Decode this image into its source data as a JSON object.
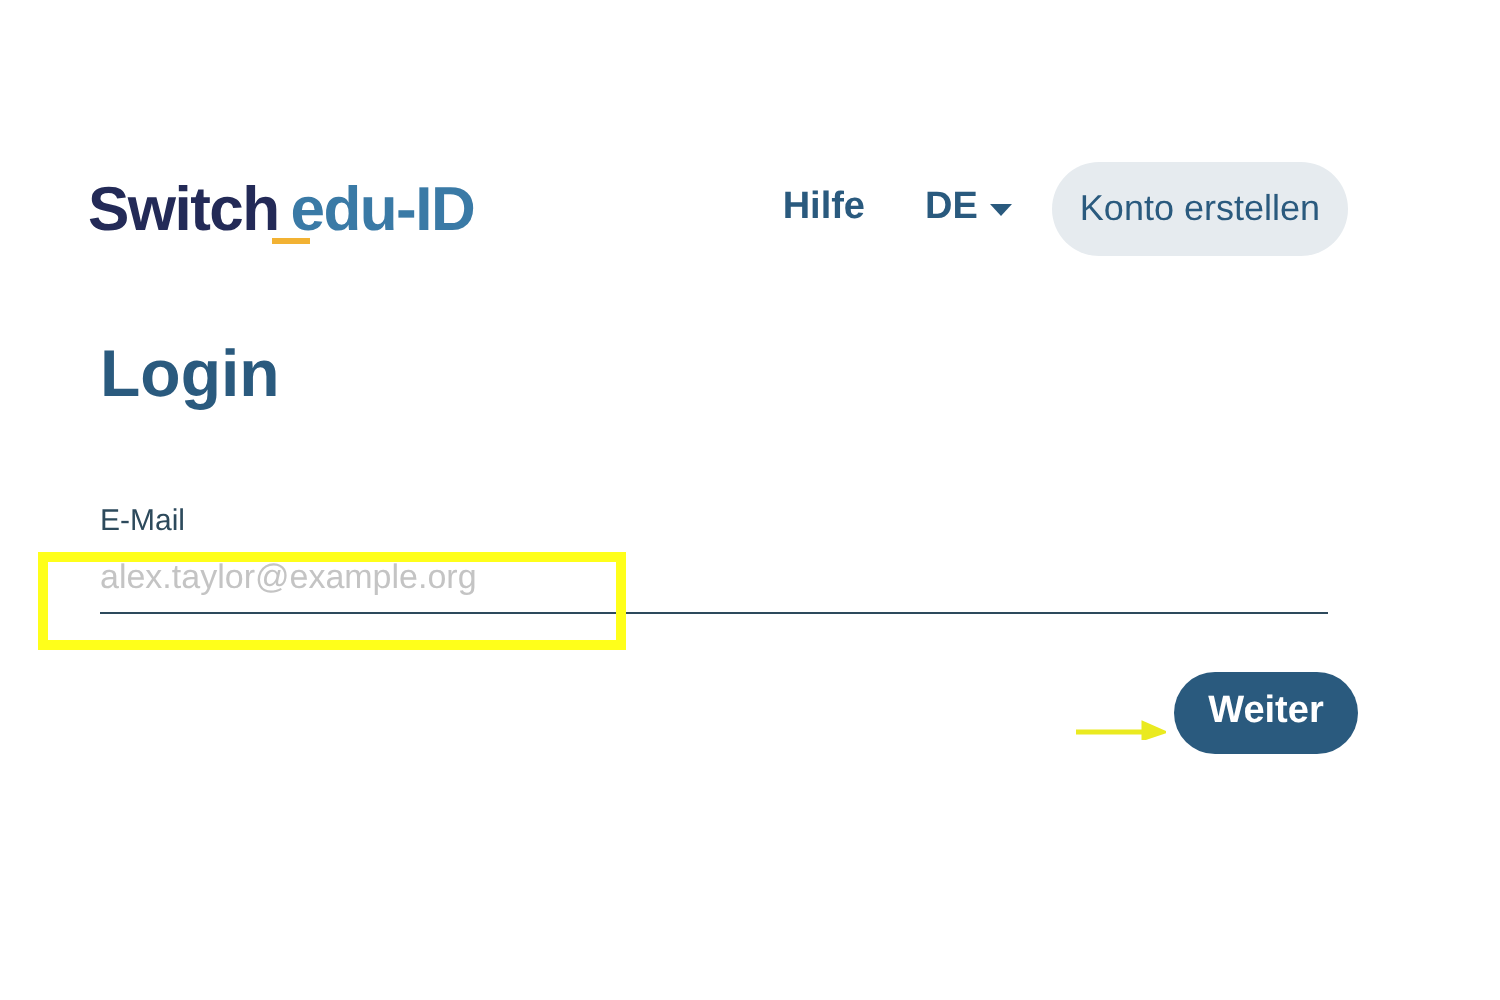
{
  "logo": {
    "brand": "Switch",
    "product": "edu-ID"
  },
  "nav": {
    "help": "Hilfe",
    "language": "DE",
    "create_account": "Konto erstellen"
  },
  "title": "Login",
  "email": {
    "label": "E-Mail",
    "placeholder": "alex.taylor@example.org"
  },
  "submit": "Weiter"
}
